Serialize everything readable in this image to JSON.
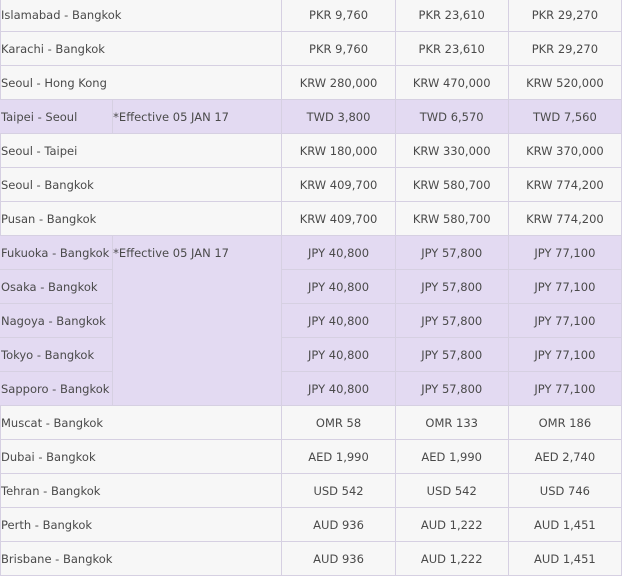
{
  "fares": {
    "rows": [
      {
        "route": "Islamabad - Bangkok",
        "f1": "PKR 9,760",
        "f2": "PKR 23,610",
        "f3": "PKR 29,270"
      },
      {
        "route": "Karachi - Bangkok",
        "f1": "PKR 9,760",
        "f2": "PKR 23,610",
        "f3": "PKR 29,270"
      },
      {
        "route": "Seoul - Hong Kong",
        "f1": "KRW 280,000",
        "f2": "KRW 470,000",
        "f3": "KRW 520,000"
      },
      {
        "route": "Taipei - Seoul",
        "note": "*Effective 05 JAN 17",
        "f1": "TWD 3,800",
        "f2": "TWD 6,570",
        "f3": "TWD 7,560"
      },
      {
        "route": "Seoul - Taipei",
        "f1": "KRW 180,000",
        "f2": "KRW 330,000",
        "f3": "KRW 370,000"
      },
      {
        "route": "Seoul - Bangkok",
        "f1": "KRW 409,700",
        "f2": "KRW 580,700",
        "f3": "KRW 774,200"
      },
      {
        "route": "Pusan - Bangkok",
        "f1": "KRW 409,700",
        "f2": "KRW 580,700",
        "f3": "KRW 774,200"
      },
      {
        "route": "Fukuoka - Bangkok",
        "note": "*Effective 05 JAN 17",
        "f1": "JPY 40,800",
        "f2": "JPY 57,800",
        "f3": "JPY 77,100"
      },
      {
        "route": "Osaka - Bangkok",
        "f1": "JPY 40,800",
        "f2": "JPY 57,800",
        "f3": "JPY 77,100"
      },
      {
        "route": "Nagoya - Bangkok",
        "f1": "JPY 40,800",
        "f2": "JPY 57,800",
        "f3": "JPY 77,100"
      },
      {
        "route": "Tokyo - Bangkok",
        "f1": "JPY 40,800",
        "f2": "JPY 57,800",
        "f3": "JPY 77,100"
      },
      {
        "route": "Sapporo - Bangkok",
        "f1": "JPY 40,800",
        "f2": "JPY 57,800",
        "f3": "JPY 77,100"
      },
      {
        "route": "Muscat - Bangkok",
        "f1": "OMR 58",
        "f2": "OMR 133",
        "f3": "OMR 186"
      },
      {
        "route": "Dubai - Bangkok",
        "f1": "AED 1,990",
        "f2": "AED 1,990",
        "f3": "AED 2,740"
      },
      {
        "route": "Tehran - Bangkok",
        "f1": "USD 542",
        "f2": "USD 542",
        "f3": "USD 746"
      },
      {
        "route": "Perth - Bangkok",
        "f1": "AUD 936",
        "f2": "AUD 1,222",
        "f3": "AUD 1,451"
      },
      {
        "route": "Brisbane - Bangkok",
        "f1": "AUD 936",
        "f2": "AUD 1,222",
        "f3": "AUD 1,451"
      }
    ]
  },
  "colors": {
    "row_background": "#f7f7f7",
    "highlight_background": "#e3daf2",
    "border": "#d6d0e2",
    "text": "#4a4a4a"
  }
}
